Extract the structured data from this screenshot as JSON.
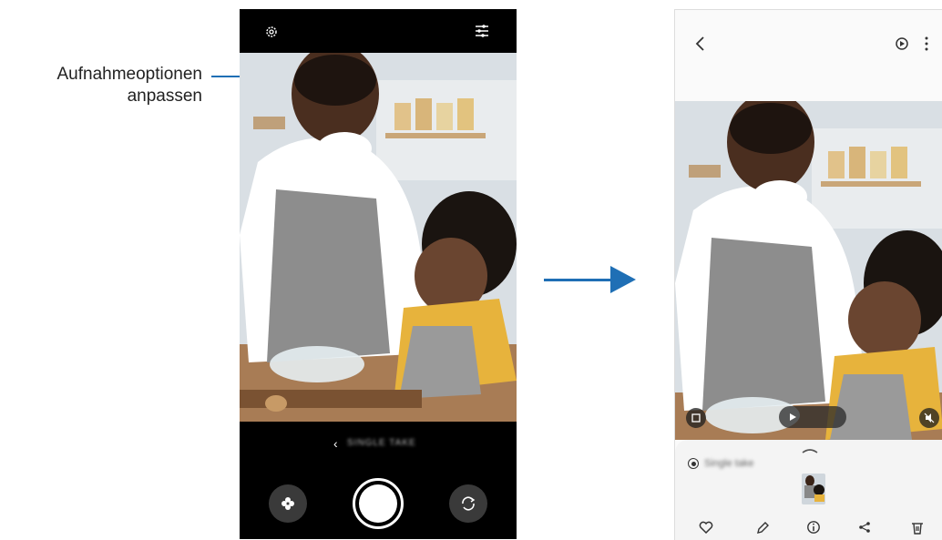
{
  "callout": {
    "line1": "Aufnahmeoptionen",
    "line2": "anpassen"
  },
  "camera": {
    "top_icons": [
      "gear-icon",
      "sliders-icon"
    ],
    "mode_label": "SINGLE TAKE",
    "bottom_icons": [
      "filter-icon",
      "shutter-button",
      "flip-camera-icon"
    ]
  },
  "gallery": {
    "header_icons": [
      "back-icon",
      "remaster-icon",
      "more-icon"
    ],
    "single_take_label": "Single take",
    "actions": [
      "heart-icon",
      "edit-icon",
      "info-icon",
      "share-icon",
      "delete-icon"
    ]
  },
  "colors": {
    "accent": "#1f6fb5",
    "camera_bg": "#000000",
    "panel_bg": "#f4f4f4"
  }
}
